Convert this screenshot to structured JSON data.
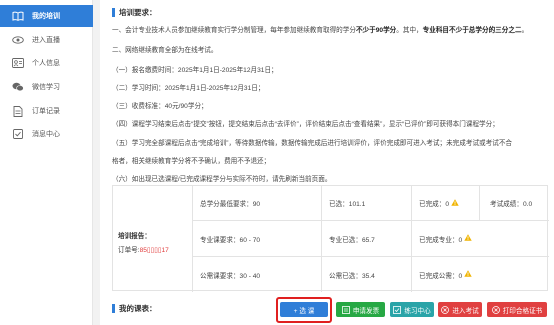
{
  "sidebar": {
    "items": [
      {
        "label": "我的培训",
        "icon": "book-icon",
        "active": true
      },
      {
        "label": "进入直播",
        "icon": "eye-icon",
        "active": false
      },
      {
        "label": "个人信息",
        "icon": "person-card-icon",
        "active": false
      },
      {
        "label": "微信学习",
        "icon": "wechat-icon",
        "active": false
      },
      {
        "label": "订单记录",
        "icon": "document-icon",
        "active": false
      },
      {
        "label": "消息中心",
        "icon": "check-square-icon",
        "active": false
      }
    ]
  },
  "requirements": {
    "title": "培训要求：",
    "line1_a": "一、会计专业技术人员参加继续教育实行学分制管理，每年参加继续教育取得的学分",
    "line1_b": "不少于90学分",
    "line1_c": "。其中，",
    "line1_d": "专业科目不少于总学分的三分之二",
    "line1_e": "。",
    "line2": "二、网络继续教育全部为在线考试。",
    "line3": "（一）报名缴费时间：2025年1月1日-2025年12月31日；",
    "line4": "（二）学习时间：2025年1月1日-2025年12月31日；",
    "line5": "（三）收费标准：40元/90学分；",
    "line6": "（四）课程学习结束后点击“提交”按钮，提交结束后点击“去评价”，评价结束后点击“查看结果”，显示“已评价”即可获得本门课程学分；",
    "line7": "（五）学习完全部课程后点击“完成培训”，等待数据传输，数据传输完成后进行培训评价，评价完成即可进入考试；未完成考试或考试不合",
    "line8": "格者，相关继续教育学分将不予确认，费用不予退还；",
    "line9": "（六）如出现已选课程/已完成课程学分与实际不符时，请先刷新当前页面。"
  },
  "report": {
    "label": "培训报告：",
    "order_prefix": "订单号:",
    "order_no": "85",
    "order_masked": "▯▯▯▯",
    "order_tail": "17",
    "total_required": "总学分最低要求：90",
    "total_selected": "已选：101.1",
    "total_completed": "已完成：0",
    "exam_score": "考试成绩：0.0",
    "major_required": "专业课要求：60 - 70",
    "major_selected": "专业已选：65.7",
    "major_completed": "已完成专业：0",
    "public_required": "公需课要求：30 - 40",
    "public_selected": "公需已选：35.4",
    "public_completed": "已完成公需：0"
  },
  "courses": {
    "title": "我的课表：",
    "select_btn": "+ 选  课",
    "invoice_btn": "申请发票",
    "practice_btn": "练习中心",
    "exam_btn": "进入考试",
    "cert_btn": "打印合格证书"
  },
  "colors": {
    "accent": "#2f7ed8",
    "green": "#27a844",
    "teal": "#2aa4a8",
    "red": "#e04040",
    "warn": "#f0b400"
  }
}
